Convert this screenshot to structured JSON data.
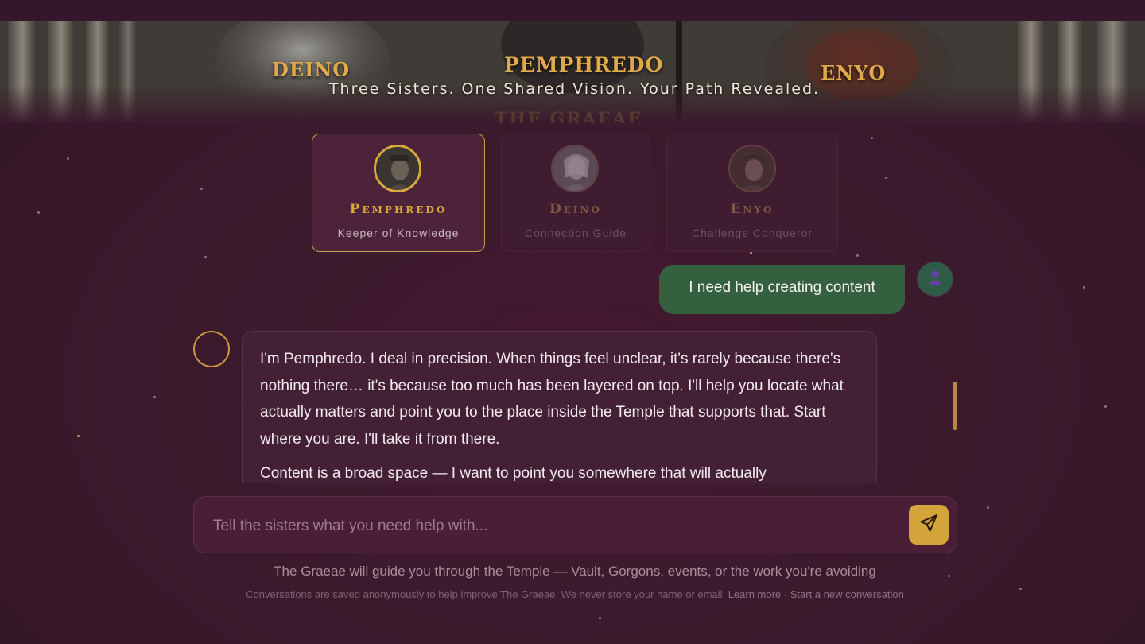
{
  "hero": {
    "left_name": "DEINO",
    "center_name": "PEMPHREDO",
    "right_name": "ENYO",
    "tagline": "Three Sisters. One Shared Vision. Your Path Revealed.",
    "ghost_title": "THE GRAEAE"
  },
  "sisters": [
    {
      "name": "Pemphredo",
      "role": "Keeper of Knowledge",
      "active": true
    },
    {
      "name": "Deino",
      "role": "Connection Guide",
      "active": false
    },
    {
      "name": "Enyo",
      "role": "Challenge Conqueror",
      "active": false
    }
  ],
  "chat": {
    "user_message": "I need help creating content",
    "assistant_paragraph_1": "I'm Pemphredo. I deal in precision. When things feel unclear, it's rarely because there's nothing there… it's because too much has been layered on top. I'll help you locate what actually matters and point you to the place inside the Temple that supports that. Start where you are. I'll take it from there.",
    "assistant_paragraph_2": "Content is a broad space — I want to point you somewhere that will actually"
  },
  "composer": {
    "placeholder": "Tell the sisters what you need help with..."
  },
  "guide_text": "The Graeae will guide you through the Temple — Vault, Gorgons, events, or the work you're avoiding",
  "footer": {
    "notice": "Conversations are saved anonymously to help improve The Graeae. We never store your name or email. ",
    "learn_more": "Learn more",
    "separator": " · ",
    "new_conversation": "Start a new conversation"
  },
  "colors": {
    "background": "#3a1a2c",
    "gold_accent": "#d9a93e",
    "user_bubble": "#35603f",
    "assistant_bubble": "#432033",
    "send_button": "#d3a53a"
  },
  "icons": {
    "send": "send-icon",
    "user": "user-icon"
  }
}
